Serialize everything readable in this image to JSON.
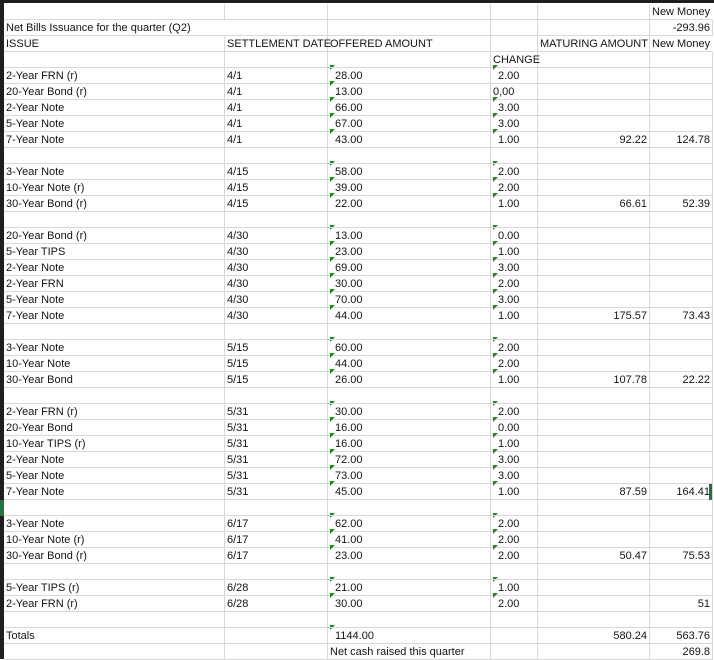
{
  "header": {
    "new_money_top": "New Money",
    "title": "Net Bills  Issuance for the quarter (Q2)",
    "net_bills_value": "-293.96",
    "col_issue": "ISSUE",
    "col_settlement": "SETTLEMENT DATE",
    "col_offered": "OFFERED AMOUNT",
    "col_maturing": "MATURING AMOUNT",
    "col_new_money": "New Money",
    "col_change": "CHANGE"
  },
  "groups": [
    {
      "rows": [
        {
          "issue": "2-Year FRN (r)",
          "date": "4/1",
          "offered": "28.00",
          "change": "2.00"
        },
        {
          "issue": "20-Year Bond (r)",
          "date": "4/1",
          "offered": "13.00",
          "change": "0,00"
        },
        {
          "issue": "2-Year Note",
          "date": "4/1",
          "offered": "66.00",
          "change": "3.00"
        },
        {
          "issue": "5-Year Note",
          "date": "4/1",
          "offered": "67.00",
          "change": "3.00"
        },
        {
          "issue": "7-Year Note",
          "date": "4/1",
          "offered": "43.00",
          "change": "1.00",
          "maturing": "92.22",
          "new_money": "124.78"
        }
      ]
    },
    {
      "rows": [
        {
          "issue": "3-Year Note",
          "date": "4/15",
          "offered": "58.00",
          "change": "2.00"
        },
        {
          "issue": "10-Year Note (r)",
          "date": "4/15",
          "offered": "39.00",
          "change": "2.00"
        },
        {
          "issue": "30-Year Bond (r)",
          "date": "4/15",
          "offered": "22.00",
          "change": "1.00",
          "maturing": "66.61",
          "new_money": "52.39"
        }
      ]
    },
    {
      "rows": [
        {
          "issue": "20-Year Bond (r)",
          "date": "4/30",
          "offered": "13.00",
          "change": "0.00"
        },
        {
          "issue": "5-Year TIPS",
          "date": "4/30",
          "offered": "23.00",
          "change": "1.00"
        },
        {
          "issue": "2-Year Note",
          "date": "4/30",
          "offered": "69.00",
          "change": "3.00"
        },
        {
          "issue": "2-Year FRN",
          "date": "4/30",
          "offered": "30.00",
          "change": "2.00"
        },
        {
          "issue": "5-Year Note",
          "date": "4/30",
          "offered": "70.00",
          "change": "3.00"
        },
        {
          "issue": "7-Year Note",
          "date": "4/30",
          "offered": "44.00",
          "change": "1.00",
          "maturing": "175.57",
          "new_money": "73.43"
        }
      ]
    },
    {
      "rows": [
        {
          "issue": "3-Year Note",
          "date": "5/15",
          "offered": "60.00",
          "change": "2.00"
        },
        {
          "issue": "10-Year Note",
          "date": "5/15",
          "offered": "44.00",
          "change": "2.00"
        },
        {
          "issue": "30-Year Bond",
          "date": "5/15",
          "offered": "26.00",
          "change": "1.00",
          "maturing": "107.78",
          "new_money": "22.22"
        }
      ]
    },
    {
      "rows": [
        {
          "issue": "2-Year FRN (r)",
          "date": "5/31",
          "offered": "30.00",
          "change": "2.00"
        },
        {
          "issue": "20-Year Bond",
          "date": "5/31",
          "offered": "16.00",
          "change": "0.00"
        },
        {
          "issue": "10-Year TIPS (r)",
          "date": "5/31",
          "offered": "16.00",
          "change": "1.00"
        },
        {
          "issue": "2-Year Note",
          "date": "5/31",
          "offered": "72.00",
          "change": "3.00"
        },
        {
          "issue": "5-Year Note",
          "date": "5/31",
          "offered": "73.00",
          "change": "3.00"
        },
        {
          "issue": "7-Year Note",
          "date": "5/31",
          "offered": "45.00",
          "change": "1.00",
          "maturing": "87.59",
          "new_money": "164.41"
        }
      ]
    },
    {
      "rows": [
        {
          "issue": "3-Year Note",
          "date": "6/17",
          "offered": "62.00",
          "change": "2.00"
        },
        {
          "issue": "10-Year Note (r)",
          "date": "6/17",
          "offered": "41.00",
          "change": "2.00"
        },
        {
          "issue": "30-Year Bond (r)",
          "date": "6/17",
          "offered": "23.00",
          "change": "2.00",
          "maturing": "50.47",
          "new_money": "75.53"
        }
      ]
    },
    {
      "rows": [
        {
          "issue": "5-Year TIPS (r)",
          "date": "6/28",
          "offered": "21.00",
          "change": "1.00"
        },
        {
          "issue": "2-Year FRN (r)",
          "date": "6/28",
          "offered": "30.00",
          "change": "2.00",
          "new_money": "51"
        }
      ]
    }
  ],
  "totals": {
    "label": "Totals",
    "offered": "1144.00",
    "maturing": "580.24",
    "new_money": "563.76",
    "net_cash_label": "Net cash raised this quarter",
    "net_cash_value": "269.8"
  }
}
